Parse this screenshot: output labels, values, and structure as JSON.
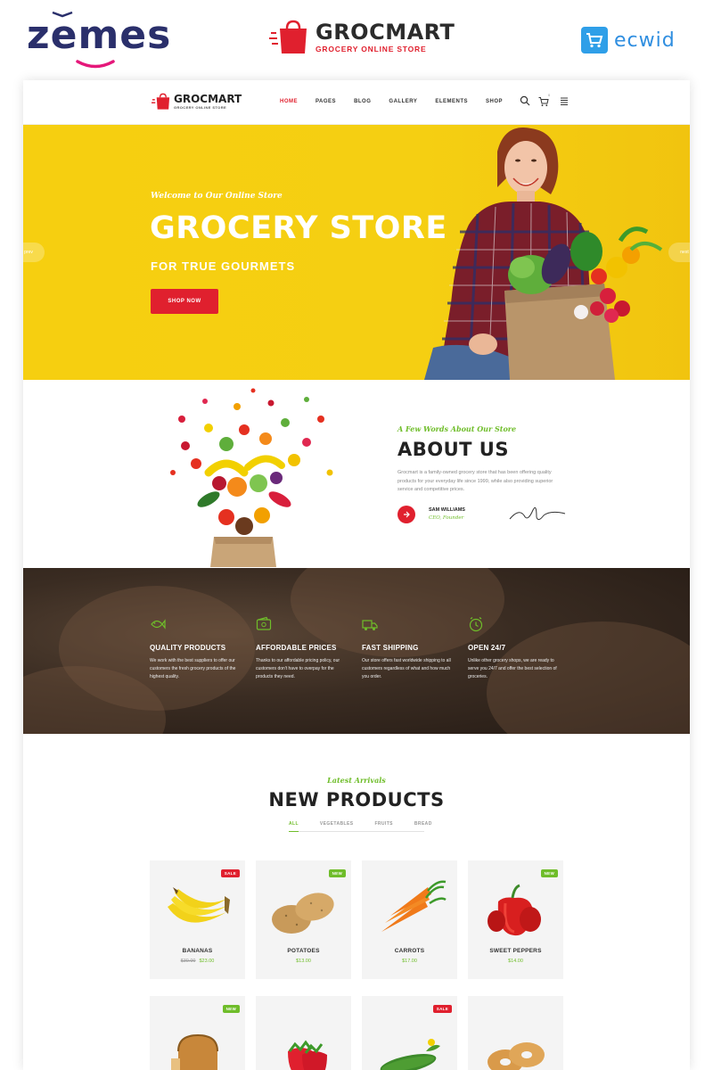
{
  "promo": {
    "zemes_logo": "zemes",
    "brand": "GROCMART",
    "brand_tagline": "GROCERY ONLINE STORE",
    "partner": "ecwid"
  },
  "nav": {
    "brand": "GROCMART",
    "tagline": "GROCERY ONLINE STORE",
    "items": [
      {
        "label": "HOME",
        "active": true
      },
      {
        "label": "PAGES",
        "active": false
      },
      {
        "label": "BLOG",
        "active": false
      },
      {
        "label": "GALLERY",
        "active": false
      },
      {
        "label": "ELEMENTS",
        "active": false
      },
      {
        "label": "SHOP",
        "active": false
      }
    ],
    "cart_count": "0"
  },
  "hero": {
    "welcome": "Welcome to Our Online Store",
    "title": "GROCERY STORE",
    "subtitle": "FOR TRUE GOURMETS",
    "cta": "SHOP NOW",
    "prev": "prev",
    "next": "next"
  },
  "about": {
    "kicker": "A Few Words About Our Store",
    "title": "ABOUT US",
    "text": "Grocmart is a family-owned grocery store that has been offering quality products for your everyday life since 1999, while also providing superior service and competitive prices.",
    "name": "SAM WILLIAMS",
    "role": "CEO, Founder"
  },
  "features": [
    {
      "icon": "fish-icon",
      "title": "QUALITY PRODUCTS",
      "text": "We work with the best suppliers to offer our customers the fresh grocery products of the highest quality."
    },
    {
      "icon": "wallet-icon",
      "title": "AFFORDABLE PRICES",
      "text": "Thanks to our affordable pricing policy, our customers don't have to overpay for the products they need."
    },
    {
      "icon": "truck-icon",
      "title": "FAST SHIPPING",
      "text": "Our store offers fast worldwide shipping to all customers regardless of what and how much you order."
    },
    {
      "icon": "clock-icon",
      "title": "OPEN 24/7",
      "text": "Unlike other grocery shops, we are ready to serve you 24/7 and offer the best selection of groceries."
    }
  ],
  "products": {
    "kicker": "Latest Arrivals",
    "title": "NEW PRODUCTS",
    "filters": [
      {
        "label": "ALL",
        "active": true
      },
      {
        "label": "VEGETABLES",
        "active": false
      },
      {
        "label": "FRUITS",
        "active": false
      },
      {
        "label": "BREAD",
        "active": false
      }
    ],
    "items": [
      {
        "name": "BANANAS",
        "old_price": "$30.00",
        "price": "$23.00",
        "badge": "SALE",
        "icon": "banana-icon"
      },
      {
        "name": "POTATOES",
        "old_price": "",
        "price": "$13.00",
        "badge": "NEW",
        "icon": "potato-icon"
      },
      {
        "name": "CARROTS",
        "old_price": "",
        "price": "$17.00",
        "badge": "",
        "icon": "carrot-icon"
      },
      {
        "name": "SWEET PEPPERS",
        "old_price": "",
        "price": "$14.00",
        "badge": "NEW",
        "icon": "pepper-icon"
      },
      {
        "name": "",
        "old_price": "",
        "price": "",
        "badge": "NEW",
        "icon": "bread-icon"
      },
      {
        "name": "",
        "old_price": "",
        "price": "",
        "badge": "",
        "icon": "strawberry-icon"
      },
      {
        "name": "",
        "old_price": "",
        "price": "",
        "badge": "SALE",
        "icon": "cucumber-icon"
      },
      {
        "name": "",
        "old_price": "",
        "price": "",
        "badge": "",
        "icon": "bagel-icon"
      }
    ]
  },
  "colors": {
    "accent_red": "#e0202e",
    "accent_green": "#6fbd2a",
    "hero_yellow": "#f5cf12"
  }
}
